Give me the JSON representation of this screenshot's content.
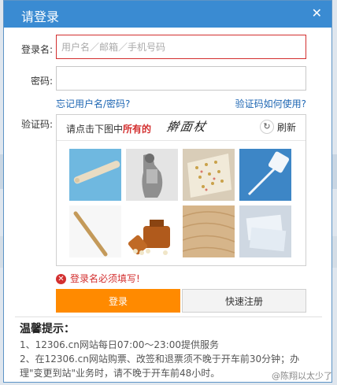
{
  "dialog": {
    "title": "请登录",
    "close_symbol": "✕"
  },
  "form": {
    "username_label": "登录名:",
    "username_placeholder": "用户名／邮箱／手机号码",
    "username_value": "",
    "password_label": "密码:",
    "password_value": "",
    "forgot_link": "忘记用户名/密码?",
    "captcha_help_link": "验证码如何使用?",
    "captcha_label": "验证码:"
  },
  "captcha": {
    "prompt_prefix": "请点击下图中",
    "prompt_emphasis": "所有的",
    "target_word": "擀面杖",
    "refresh_label": "刷新",
    "tiles": [
      {
        "subject": "rolling-pin"
      },
      {
        "subject": "figure-photo"
      },
      {
        "subject": "floral-fabric"
      },
      {
        "subject": "fly-swatter"
      },
      {
        "subject": "wooden-stick"
      },
      {
        "subject": "medicine-bottles"
      },
      {
        "subject": "wood-board"
      },
      {
        "subject": "towels"
      }
    ]
  },
  "error": {
    "message": "登录名必须填写!",
    "icon": "✕"
  },
  "buttons": {
    "login": "登录",
    "register": "快速注册"
  },
  "tips": {
    "title": "温馨提示：",
    "line1": "1、12306.cn网站每日07:00～23:00提供服务",
    "line2": "2、在12306.cn网站购票、改签和退票须不晚于开车前30分钟；办理\"变更到站\"业务时，请不晚于开车前48小时。"
  },
  "watermark": "@陈翔以太少了",
  "colors": {
    "title_bar": "#3a8bd2",
    "login_button": "#ff8a00",
    "error": "#d32f2f",
    "link": "#1d66b3"
  }
}
